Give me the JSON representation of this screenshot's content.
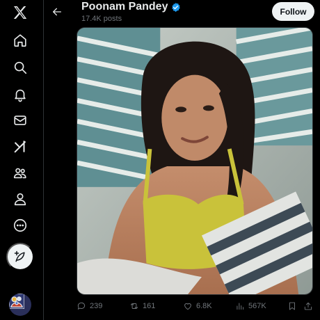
{
  "nav": {
    "items": [
      {
        "name": "x-logo-icon"
      },
      {
        "name": "home-icon"
      },
      {
        "name": "search-icon"
      },
      {
        "name": "notifications-icon"
      },
      {
        "name": "messages-icon"
      },
      {
        "name": "grok-icon"
      },
      {
        "name": "communities-icon"
      },
      {
        "name": "profile-icon"
      },
      {
        "name": "more-icon"
      }
    ],
    "compose_icon": "compose-post-icon"
  },
  "header": {
    "back_icon": "arrow-left-icon",
    "profile_name": "Poonam Pandey",
    "verified_icon": "verified-badge-icon",
    "posts_count": "17.4K posts",
    "follow_label": "Follow"
  },
  "post": {
    "media_alt": "photo",
    "actions": {
      "replies": "239",
      "reposts": "161",
      "likes": "6.8K",
      "views": "567K"
    }
  },
  "colors": {
    "background": "#000000",
    "text": "#e7e9ea",
    "muted": "#71767b",
    "verified": "#1d9bf0",
    "follow_bg": "#eff3f4"
  }
}
